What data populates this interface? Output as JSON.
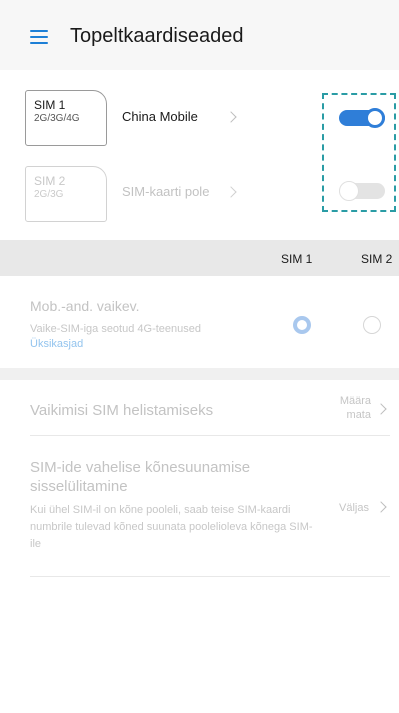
{
  "app": {
    "title": "Topeltkaardiseaded"
  },
  "sims": [
    {
      "label": "SIM 1",
      "types": "2G/3G/4G",
      "name": "China Mobile",
      "enabled": true
    },
    {
      "label": "SIM 2",
      "types": "2G/3G",
      "name": "SIM-kaarti pole",
      "enabled": false
    }
  ],
  "columns": {
    "sim1": "SIM 1",
    "sim2": "SIM 2"
  },
  "mobile_data": {
    "title": "Mob.-and. vaikev.",
    "subtitle": "Vaike-SIM-iga seotud 4G-teenused",
    "link": "Üksikasjad",
    "selected": "SIM 1"
  },
  "default_call": {
    "title": "Vaikimisi SIM helistamiseks",
    "value_line1": "Määra",
    "value_line2": "mata"
  },
  "call_forwarding": {
    "title_line1": "SIM-ide vahelise kõnesuunamise",
    "title_line2": "sisselülitamine",
    "description": "Kui ühel SIM-il on kõne pooleli, saab teise SIM-kaardi numbrile tulevad kõned suunata poolelioleva kõnega SIM-ile",
    "value": "Väljas"
  },
  "colors": {
    "accent": "#1d7fd6",
    "highlight": "#2a9ca5",
    "toggle_on": "#2f7ed8",
    "toggle_off": "#e3e3e3"
  }
}
